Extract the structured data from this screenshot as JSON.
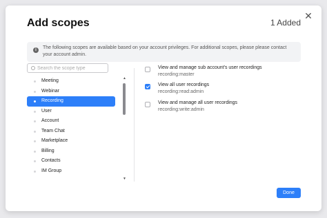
{
  "modal": {
    "title": "Add scopes",
    "added_count": "1 Added",
    "close_glyph": "✕"
  },
  "info": {
    "icon_glyph": "i",
    "text": "The following scopes are available based on your account privileges. For additional scopes, please please contact your account admin."
  },
  "search": {
    "placeholder": "Search the scope type",
    "value": ""
  },
  "categories": [
    {
      "label": "Meeting",
      "selected": false
    },
    {
      "label": "Webinar",
      "selected": false
    },
    {
      "label": "Recording",
      "selected": true
    },
    {
      "label": "User",
      "selected": false
    },
    {
      "label": "Account",
      "selected": false
    },
    {
      "label": "Team Chat",
      "selected": false
    },
    {
      "label": "Marketplace",
      "selected": false
    },
    {
      "label": "Billing",
      "selected": false
    },
    {
      "label": "Contacts",
      "selected": false
    },
    {
      "label": "IM Group",
      "selected": false
    }
  ],
  "scrollbar": {
    "up_glyph": "▲",
    "down_glyph": "▼"
  },
  "scopes": [
    {
      "title": "View and manage sub account's user recordings",
      "id": "recording:master",
      "checked": false
    },
    {
      "title": "View all user recordings",
      "id": "recording:read:admin",
      "checked": true
    },
    {
      "title": "View and manage all user recordings",
      "id": "recording:write:admin",
      "checked": false
    }
  ],
  "footer": {
    "done_label": "Done"
  },
  "colors": {
    "accent": "#2d7ff9",
    "overlay": "#e9e9ec",
    "info_bg": "#f2f3f5"
  }
}
